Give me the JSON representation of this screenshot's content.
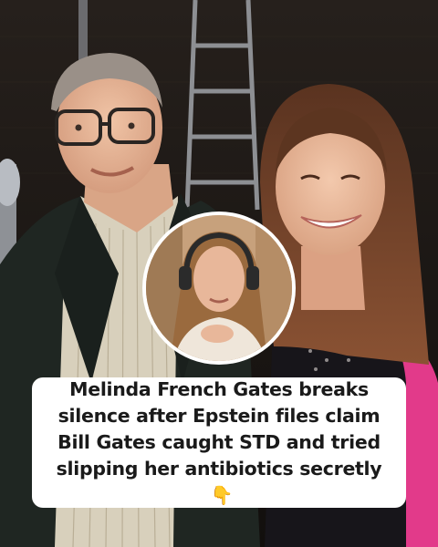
{
  "post": {
    "photo_description_hidden": "",
    "caption_lines": [
      "Melinda French Gates breaks",
      "silence after Epstein files claim",
      "Bill Gates caught STD and tried",
      "slipping her antibiotics secretly"
    ],
    "emoji": "👇",
    "colors": {
      "caption_bg": "#ffffff",
      "caption_text": "#1a1a1a",
      "inset_border": "#ffffff",
      "background_dark": "#1b1714",
      "jacket_pink": "#e23a8a"
    },
    "icons": [
      "pointing-down-emoji"
    ]
  }
}
